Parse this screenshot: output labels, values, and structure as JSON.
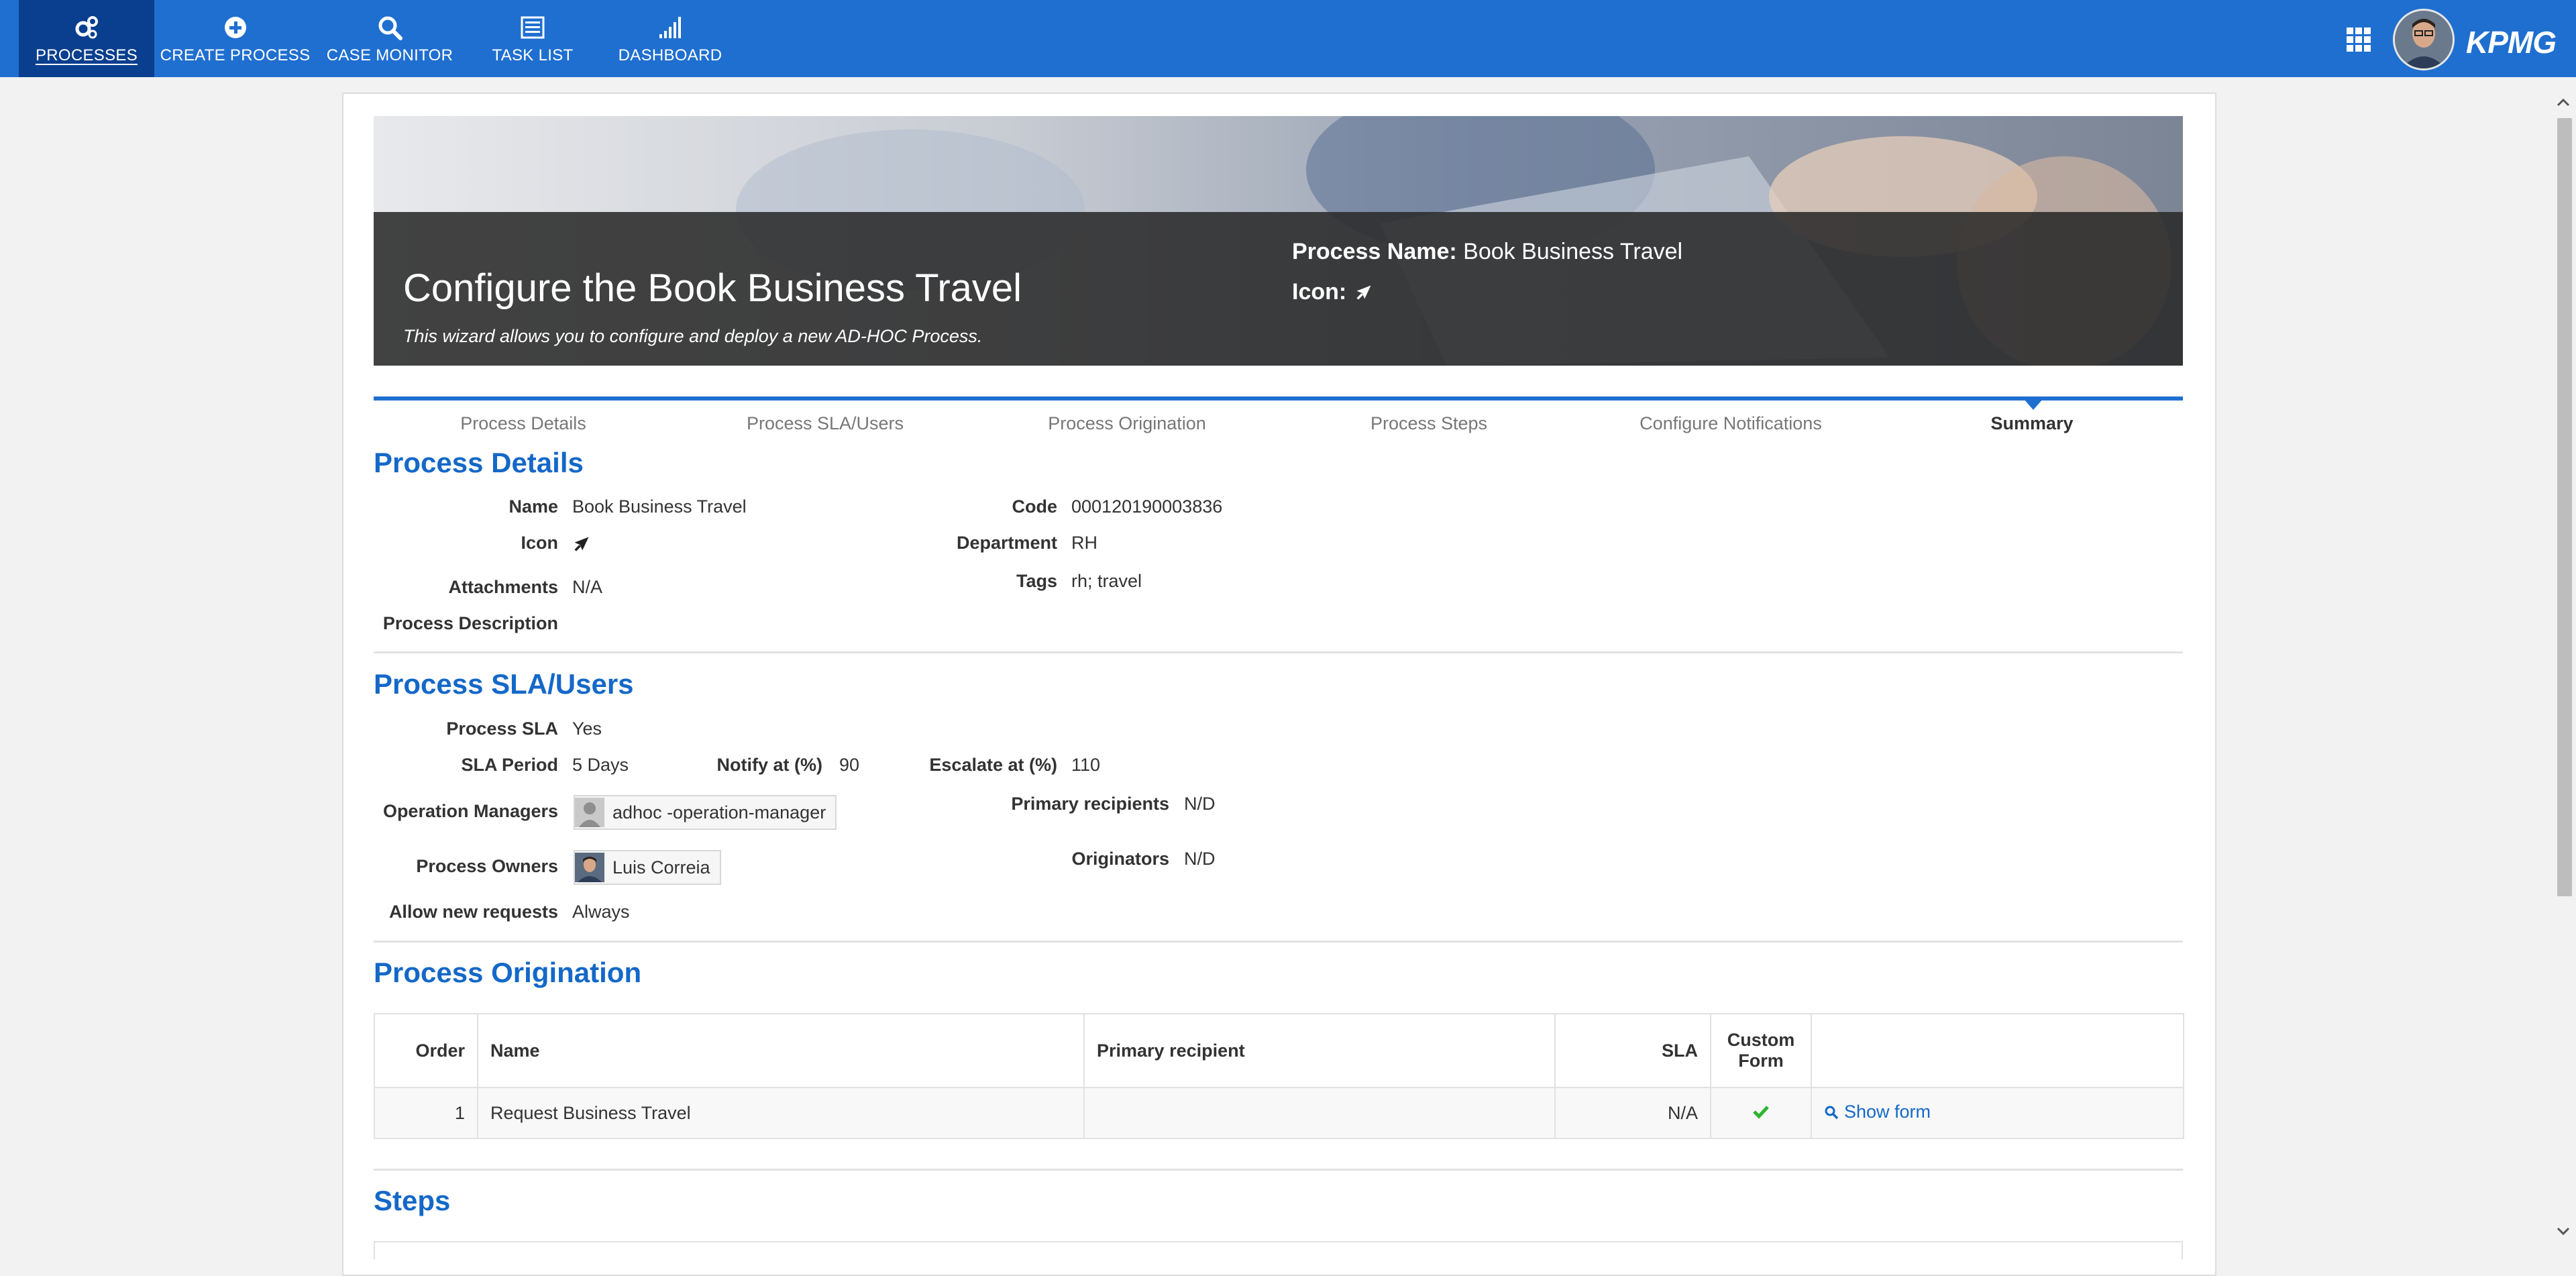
{
  "nav": {
    "items": [
      {
        "label": "PROCESSES",
        "icon": "gears-icon",
        "active": true
      },
      {
        "label": "CREATE PROCESS",
        "icon": "plus-circle-icon"
      },
      {
        "label": "CASE MONITOR",
        "icon": "search-icon"
      },
      {
        "label": "TASK LIST",
        "icon": "list-icon"
      },
      {
        "label": "DASHBOARD",
        "icon": "signal-bars-icon"
      }
    ],
    "brand": "KPMG",
    "apps_icon": "grid-icon"
  },
  "hero": {
    "title": "Configure the Book Business Travel",
    "subtitle": "This wizard allows you to configure and deploy a new AD-HOC Process.",
    "process_name_label": "Process Name:",
    "process_name": "Book Business Travel",
    "icon_label": "Icon:",
    "icon": "plane-icon"
  },
  "wizard_steps": [
    {
      "label": "Process Details"
    },
    {
      "label": "Process SLA/Users"
    },
    {
      "label": "Process Origination"
    },
    {
      "label": "Process Steps"
    },
    {
      "label": "Configure Notifications"
    },
    {
      "label": "Summary",
      "current": true
    }
  ],
  "details": {
    "title": "Process Details",
    "name_label": "Name",
    "name": "Book Business Travel",
    "icon_label": "Icon",
    "attachments_label": "Attachments",
    "attachments": "N/A",
    "description_label": "Process Description",
    "code_label": "Code",
    "code": "000120190003836",
    "department_label": "Department",
    "department": "RH",
    "tags_label": "Tags",
    "tags": "rh; travel"
  },
  "sla": {
    "title": "Process SLA/Users",
    "process_sla_label": "Process SLA",
    "process_sla": "Yes",
    "sla_period_label": "SLA Period",
    "sla_period": "5 Days",
    "notify_label": "Notify at (%)",
    "notify": "90",
    "escalate_label": "Escalate at (%)",
    "escalate": "110",
    "op_managers_label": "Operation Managers",
    "op_manager": "adhoc -operation-manager",
    "owners_label": "Process Owners",
    "owner": "Luis Correia",
    "allow_label": "Allow new requests",
    "allow": "Always",
    "primary_label": "Primary recipients",
    "primary": "N/D",
    "originators_label": "Originators",
    "originators": "N/D"
  },
  "origination": {
    "title": "Process Origination",
    "columns": {
      "order": "Order",
      "name": "Name",
      "primary": "Primary recipient",
      "sla": "SLA",
      "custom_form_1": "Custom",
      "custom_form_2": "Form"
    },
    "rows": [
      {
        "order": "1",
        "name": "Request Business Travel",
        "primary": "",
        "sla": "N/A",
        "custom_form": "check-icon",
        "action": "Show form"
      }
    ]
  },
  "steps": {
    "title": "Steps"
  },
  "colors": {
    "nav_bg": "#1f6fd0",
    "nav_active": "#0a3f8f",
    "section_title": "#1468c8",
    "check": "#2db52d"
  }
}
